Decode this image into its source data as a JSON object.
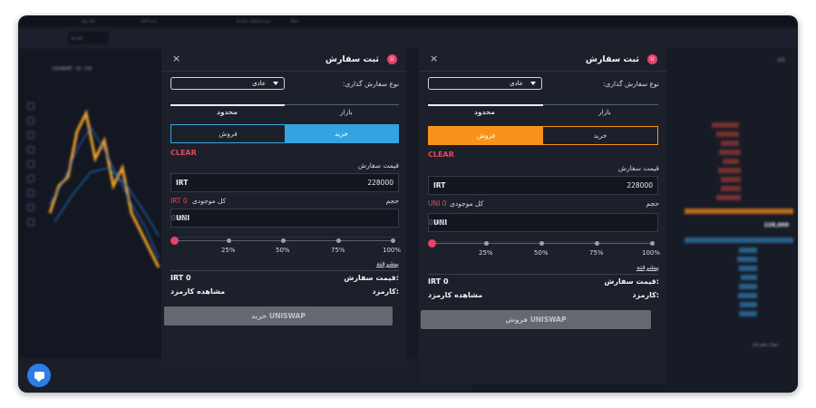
{
  "background": {
    "topbar": [
      "شبکه",
      "خرید و فروش حرفه ای",
      "خرید آسان",
      "کیف پول"
    ],
    "chart_tab": "ابزار ها",
    "chart_symbol": "CXXUNI/IRT · 1D · CXX",
    "orderbook_title": "بازار",
    "orderbook_mid": "228,000",
    "depth_title": "نمودار عمق بازار"
  },
  "colors": {
    "panel_bg": "#1c202a",
    "buy_active": "#34a4e0",
    "sell_active": "#f7931a",
    "danger": "#e24a5b",
    "submit_disabled": "#646870"
  },
  "left_panel": {
    "title": "ثبت سفارش",
    "close_icon": "×",
    "order_type_label": "نوع سفارش گذاری:",
    "order_type_value": "عادی",
    "tab_market": "بازار",
    "tab_limit": "محدود",
    "seg_buy": "خرید",
    "seg_sell": "فروش",
    "active_side": "buy",
    "clear": "CLEAR",
    "price_label": "قیمت سفارش",
    "price_currency": "IRT",
    "price_value": "228000",
    "volume_label": "حجم",
    "balance_label": "کل موجودی",
    "balance_value": "IRT 0",
    "volume_currency": "UNI",
    "volume_placeholder": "0.00",
    "slider_marks": [
      "25%",
      "50%",
      "75%",
      "100%"
    ],
    "slider_percent": 0,
    "advanced": "پیشرفته",
    "order_price_label": "قیمت سفارش:",
    "order_price_value": "IRT 0",
    "fee_label": "کارمزد:",
    "fee_link": "مشاهده کارمزد",
    "submit": "خرید UNISWAP"
  },
  "right_panel": {
    "title": "ثبت سفارش",
    "close_icon": "×",
    "order_type_label": "نوع سفارش گذاری:",
    "order_type_value": "عادی",
    "tab_market": "بازار",
    "tab_limit": "محدود",
    "seg_buy": "خرید",
    "seg_sell": "فروش",
    "active_side": "sell",
    "clear": "CLEAR",
    "price_label": "قیمت سفارش",
    "price_currency": "IRT",
    "price_value": "228000",
    "volume_label": "حجم",
    "balance_label": "کل موجودی",
    "balance_value": "UNI 0",
    "volume_currency": "UNI",
    "volume_placeholder": "0.00",
    "slider_marks": [
      "25%",
      "50%",
      "75%",
      "100%"
    ],
    "slider_percent": 0,
    "advanced": "پیشرفته",
    "order_price_label": "قیمت سفارش:",
    "order_price_value": "IRT 0",
    "fee_label": "کارمزد:",
    "fee_link": "مشاهده کارمزد",
    "submit": "فروش UNISWAP"
  }
}
